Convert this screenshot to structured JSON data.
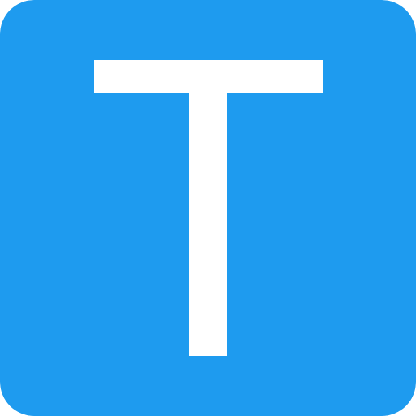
{
  "app_icon": {
    "letter": "T",
    "background_color": "#1E9BEF",
    "glyph_color": "#FFFFFF",
    "icon_name": "letter-t-icon"
  }
}
